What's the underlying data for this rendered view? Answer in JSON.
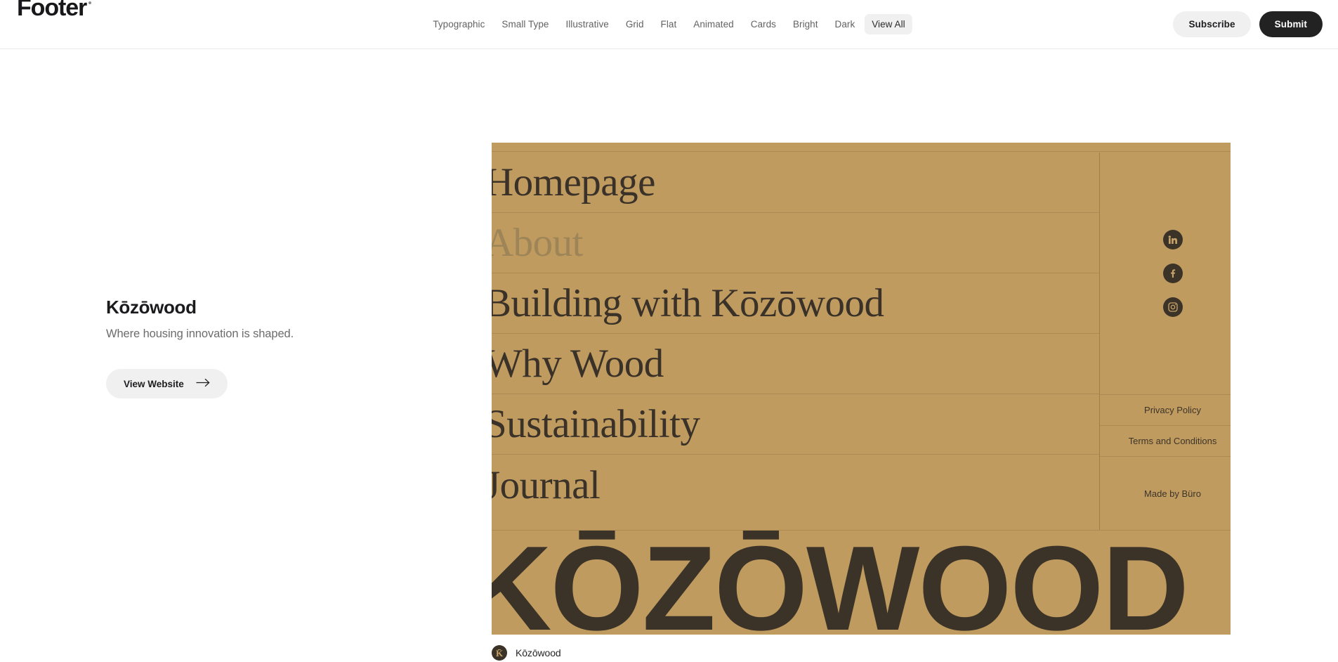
{
  "header": {
    "brand": "Footer",
    "nav": [
      {
        "label": "Typographic",
        "active": false
      },
      {
        "label": "Small Type",
        "active": false
      },
      {
        "label": "Illustrative",
        "active": false
      },
      {
        "label": "Grid",
        "active": false
      },
      {
        "label": "Flat",
        "active": false
      },
      {
        "label": "Animated",
        "active": false
      },
      {
        "label": "Cards",
        "active": false
      },
      {
        "label": "Bright",
        "active": false
      },
      {
        "label": "Dark",
        "active": false
      },
      {
        "label": "View All",
        "active": true
      }
    ],
    "subscribe_label": "Subscribe",
    "submit_label": "Submit"
  },
  "info": {
    "title": "Kōzōwood",
    "subtitle": "Where housing innovation is shaped.",
    "cta_label": "View Website"
  },
  "preview": {
    "background_color": "#bf9b5f",
    "ink_color": "#3b3228",
    "nav_links": [
      {
        "label": "Homepage",
        "dim": false
      },
      {
        "label": "About",
        "dim": true
      },
      {
        "label": "Building with Kōzōwood",
        "dim": false
      },
      {
        "label": "Why Wood",
        "dim": false
      },
      {
        "label": "Sustainability",
        "dim": false
      },
      {
        "label": "Journal",
        "dim": false
      }
    ],
    "socials": [
      {
        "name": "linkedin"
      },
      {
        "name": "facebook"
      },
      {
        "name": "instagram"
      }
    ],
    "legal": [
      "Privacy Policy",
      "Terms and Conditions"
    ],
    "credit": "Made by Büro",
    "wordmark": "KŌZŌWOOD"
  },
  "caption": {
    "avatar_initial": "K̄",
    "label": "Kōzōwood"
  }
}
